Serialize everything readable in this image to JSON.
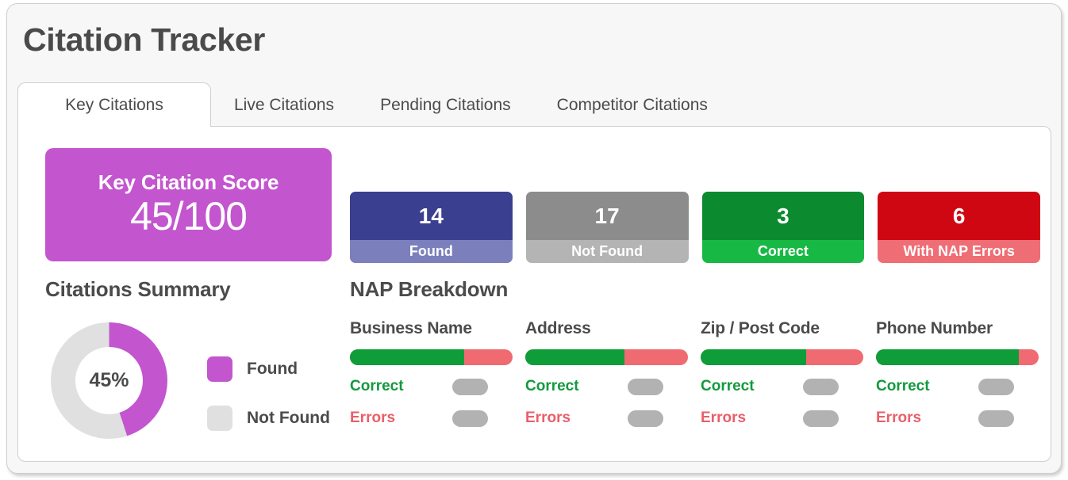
{
  "header": {
    "title": "Citation Tracker"
  },
  "tabs": [
    {
      "label": "Key Citations",
      "active": true
    },
    {
      "label": "Live Citations",
      "active": false
    },
    {
      "label": "Pending Citations",
      "active": false
    },
    {
      "label": "Competitor Citations",
      "active": false
    }
  ],
  "score_card": {
    "label": "Key Citation Score",
    "value": "45/100",
    "background": "#c355cf"
  },
  "stat_cards": [
    {
      "value": "14",
      "caption": "Found",
      "top_color": "#3b3f8f",
      "bottom_color": "#7b80bd"
    },
    {
      "value": "17",
      "caption": "Not Found",
      "top_color": "#8c8c8c",
      "bottom_color": "#b4b4b4"
    },
    {
      "value": "3",
      "caption": "Correct",
      "top_color": "#0b8a30",
      "bottom_color": "#18b845"
    },
    {
      "value": "6",
      "caption": "With NAP Errors",
      "top_color": "#cf0712",
      "bottom_color": "#ef6d74"
    }
  ],
  "citations_summary": {
    "heading": "Citations Summary",
    "legend": [
      {
        "label": "Found",
        "color": "#c355cf"
      },
      {
        "label": "Not Found",
        "color": "#e0e0e0"
      }
    ]
  },
  "nap": {
    "heading": "NAP Breakdown",
    "correct_label": "Correct",
    "errors_label": "Errors",
    "columns": [
      {
        "title": "Business Name",
        "correct_pct": 70
      },
      {
        "title": "Address",
        "correct_pct": 61
      },
      {
        "title": "Zip / Post Code",
        "correct_pct": 65
      },
      {
        "title": "Phone Number",
        "correct_pct": 88
      }
    ]
  },
  "chart_data": {
    "type": "pie",
    "title": "Citations Summary",
    "center_label": "45%",
    "labels": [
      "Found",
      "Not Found"
    ],
    "values": [
      45,
      55
    ],
    "colors": [
      "#c355cf",
      "#e0e0e0"
    ],
    "donut": true,
    "legend_position": "right",
    "grid": false
  }
}
